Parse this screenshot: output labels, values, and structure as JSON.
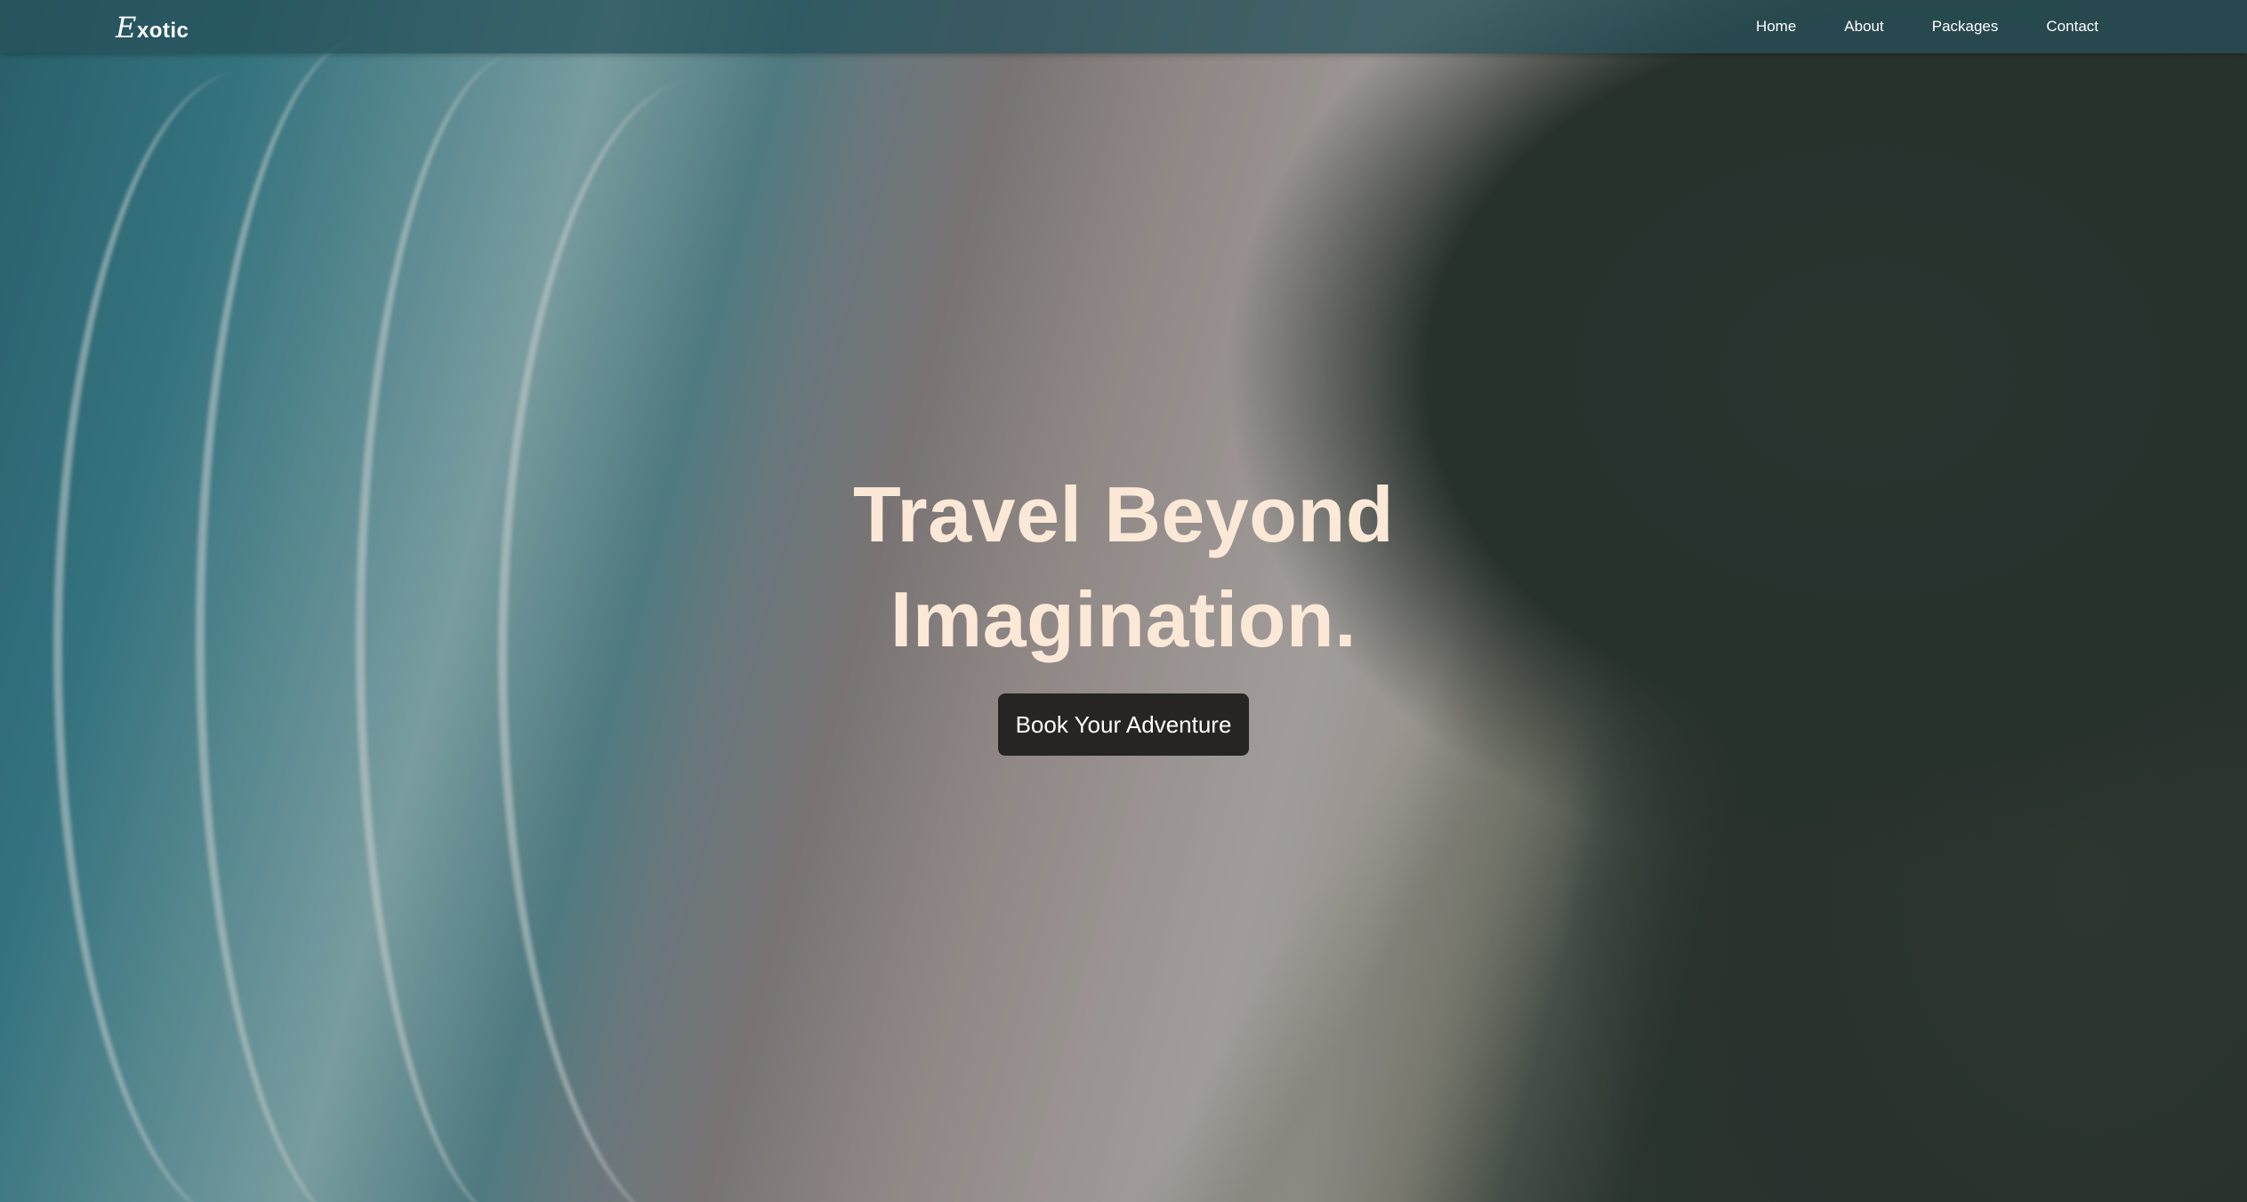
{
  "brand": {
    "logo_initial": "E",
    "logo_rest": "xotic"
  },
  "nav": {
    "items": [
      {
        "label": "Home"
      },
      {
        "label": "About"
      },
      {
        "label": "Packages"
      },
      {
        "label": "Contact"
      }
    ]
  },
  "hero": {
    "title_line1": "Travel Beyond",
    "title_line2": "Imagination.",
    "cta_label": "Book Your Adventure"
  },
  "colors": {
    "nav_bg": "#26505a",
    "title_text": "#fbe8d7",
    "cta_bg": "#262524",
    "cta_text": "#ffffff"
  }
}
